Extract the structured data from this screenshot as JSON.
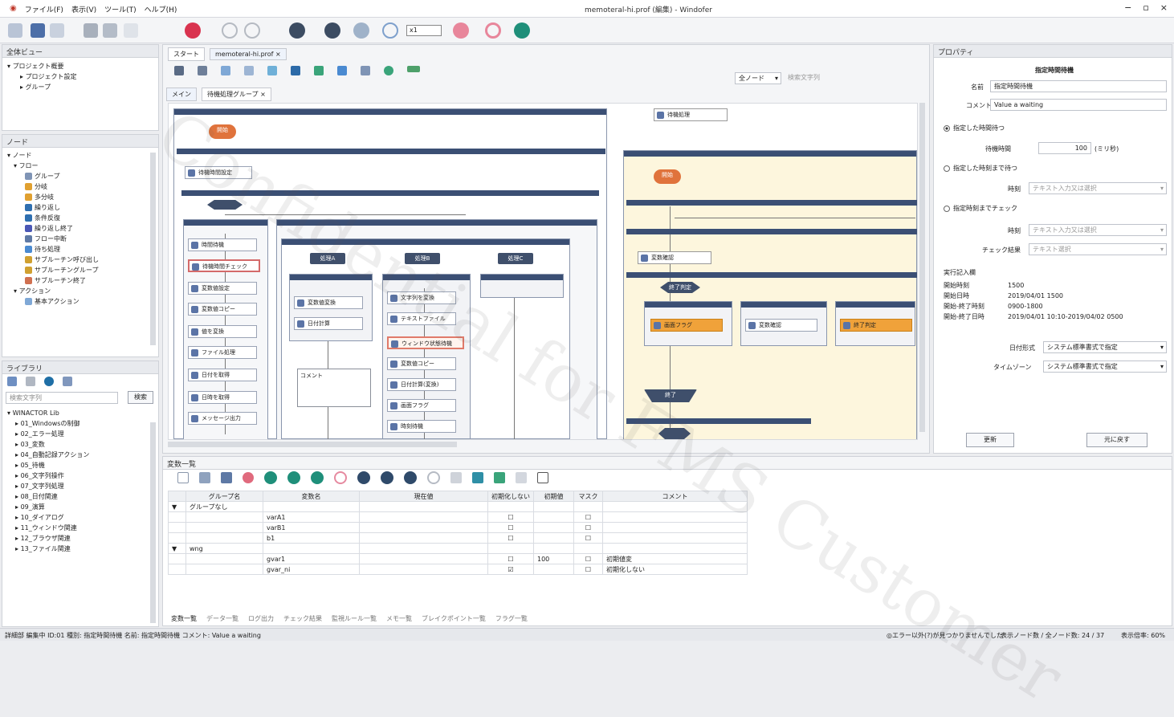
{
  "app": {
    "title": "memoteral-hi.prof (編集) - Windofer",
    "menu": [
      "ファイル(F)",
      "表示(V)",
      "ツール(T)",
      "ヘルプ(H)"
    ],
    "window_controls": [
      "−",
      "▫",
      "×"
    ]
  },
  "toolbar": {
    "select_value": "x1",
    "colors": {
      "red": "#d9334f",
      "teal": "#1f8f7a",
      "pink": "#e8869b",
      "blue": "#5a8fd1",
      "gray": "#9aa0a8"
    }
  },
  "left": {
    "project_panel": {
      "title": "全体ビュー",
      "items": [
        "プロジェクト概要",
        "プロジェクト設定",
        "グループ"
      ]
    },
    "node_panel": {
      "title": "ノード",
      "root": "ノード",
      "flow": "フロー",
      "items": [
        "グループ",
        "分岐",
        "多分岐",
        "繰り返し",
        "条件反復",
        "繰り返し終了",
        "フロー中断",
        "待ち処理",
        "サブルーチン呼び出し",
        "サブルーチングループ",
        "サブルーチン終了"
      ],
      "action_header": "アクション",
      "action_items": [
        "基本アクション"
      ]
    },
    "library_panel": {
      "title": "ライブラリ",
      "search_placeholder": "検索文字列",
      "search_button": "検索",
      "root": "WINACTOR Lib",
      "items": [
        "01_Windowsの制御",
        "02_エラー処理",
        "03_変数",
        "04_自動記録アクション",
        "05_待機",
        "06_文字列操作",
        "07_文字列処理",
        "08_日付関連",
        "09_演算",
        "10_ダイアログ",
        "11_ウィンドウ関連",
        "12_ブラウザ関連",
        "13_ファイル関連"
      ]
    }
  },
  "editor": {
    "tabs": [
      {
        "label": "スタート",
        "close": ""
      },
      {
        "label": "memoteral-hi.prof",
        "close": "×"
      }
    ],
    "subtabs": [
      {
        "label": "メイン",
        "close": ""
      },
      {
        "label": "待機処理グループ",
        "close": "×"
      }
    ],
    "view_select": "全ノード",
    "search_placeholder": "検索文字列",
    "start_label": "開始",
    "end_label": "終了",
    "nodes": {
      "n1": "待機時間設定",
      "n2": "時間待機",
      "n3": "変数値設定",
      "n4": "待機時間チェック",
      "n5": "変数値コピー",
      "n6": "値を変換",
      "n7": "ファイル処理",
      "n8": "ウィンドウ状態待機",
      "n9": "日付を取得",
      "n10": "日時を取得",
      "n11": "メッセージ出力",
      "n12": "変数値変換",
      "n13": "日付計算",
      "n14": "文字列を変換",
      "n15": "テキストファイル",
      "n16": "変数値コピー",
      "n17": "日付計算(変換)",
      "n18": "画面フラグ",
      "n19": "時刻待機",
      "n20": "終了判定",
      "n21": "変数確認",
      "n22": "画面フラグ",
      "n23": "変数確認",
      "n24": "終了判定",
      "n25": "待機処理"
    },
    "labels": {
      "a": "処理A",
      "b": "処理B",
      "c": "処理C",
      "note": "コメント"
    }
  },
  "properties": {
    "title": "プロパティ",
    "node_title": "指定時間待機",
    "name_label": "名前",
    "name_value": "指定時間待機",
    "comment_label": "コメント",
    "comment_value": "Value a waiting",
    "option1": "指定した時間待つ",
    "wait_label": "待機時間",
    "wait_value": "100",
    "wait_unit": "(ミリ秒)",
    "option2": "指定した時刻まで待つ",
    "time_label": "時刻",
    "time_value": "テキスト入力又は選択",
    "option3": "指定時刻までチェック",
    "time2_label": "時刻",
    "time2_value": "テキスト入力又は選択",
    "check_label": "チェック結果",
    "check_value": "テキスト選択",
    "info_title": "実行記入欄",
    "info": [
      {
        "k": "開始時刻",
        "v": "1500"
      },
      {
        "k": "開始日時",
        "v": "2019/04/01 1500"
      },
      {
        "k": "開始-終了時刻",
        "v": "0900-1800"
      },
      {
        "k": "開始-終了日時",
        "v": "2019/04/01 10:10-2019/04/02 0500"
      }
    ],
    "sel1_label": "日付形式",
    "sel1_value": "システム標準書式で指定",
    "sel2_label": "タイムゾーン",
    "sel2_value": "システム標準書式で指定",
    "ok_button": "更新",
    "cancel_button": "元に戻す"
  },
  "varlist": {
    "title": "変数一覧",
    "columns": [
      "",
      "グループ名",
      "変数名",
      "現在値",
      "初期化しない",
      "初期値",
      "マスク",
      "コメント"
    ],
    "rows": [
      {
        "expand": "▼",
        "group": "グループなし",
        "name": "",
        "value": "",
        "noinit": "",
        "init": "",
        "mask": "",
        "comment": "",
        "isgroup": true
      },
      {
        "expand": "",
        "group": "",
        "name": "varA1",
        "value": "",
        "noinit": "☐",
        "init": "",
        "mask": "☐",
        "comment": "",
        "isgroup": false
      },
      {
        "expand": "",
        "group": "",
        "name": "varB1",
        "value": "",
        "noinit": "☐",
        "init": "",
        "mask": "☐",
        "comment": "",
        "isgroup": false
      },
      {
        "expand": "",
        "group": "",
        "name": "b1",
        "value": "",
        "noinit": "☐",
        "init": "",
        "mask": "☐",
        "comment": "",
        "isgroup": false
      },
      {
        "expand": "▼",
        "group": "wng",
        "name": "",
        "value": "",
        "noinit": "",
        "init": "",
        "mask": "",
        "comment": "",
        "isgroup": true
      },
      {
        "expand": "",
        "group": "",
        "name": "gvar1",
        "value": "",
        "noinit": "☐",
        "init": "100",
        "mask": "☐",
        "comment": "初期値変",
        "isgroup": false
      },
      {
        "expand": "",
        "group": "",
        "name": "gvar_ni",
        "value": "",
        "noinit": "☑",
        "init": "",
        "mask": "☐",
        "comment": "初期化しない",
        "isgroup": false
      }
    ],
    "bottom_tabs": [
      "変数一覧",
      "データ一覧",
      "ログ出力",
      "チェック結果",
      "監視ルール一覧",
      "メモ一覧",
      "ブレイクポイント一覧",
      "フラグ一覧"
    ]
  },
  "status": {
    "left": "詳細部 編集中  ID:01 種別: 指定時間待機 名前: 指定時間待機 コメント: Value a waiting",
    "mid": "◎エラー以外(?)が見つかりませんでした",
    "right1": "表示ノード数 / 全ノード数: 24 / 37",
    "right2": "表示倍率: 60%"
  },
  "watermark": "Confidential for FMS Customer"
}
